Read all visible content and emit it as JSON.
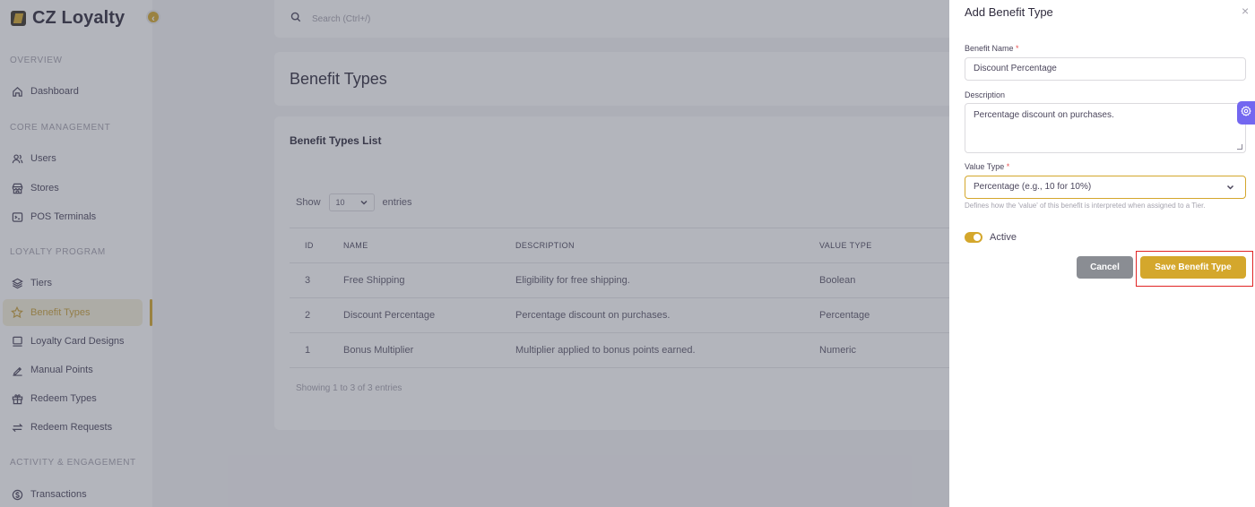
{
  "brand": {
    "name": "CZ Loyalty"
  },
  "sidebar": {
    "sections": {
      "overview": "OVERVIEW",
      "core": "CORE MANAGEMENT",
      "loyalty": "LOYALTY PROGRAM",
      "activity": "ACTIVITY & ENGAGEMENT"
    },
    "items": [
      {
        "label": "Dashboard",
        "icon": "home-icon"
      },
      {
        "label": "Users",
        "icon": "users-icon"
      },
      {
        "label": "Stores",
        "icon": "store-icon"
      },
      {
        "label": "POS Terminals",
        "icon": "terminal-icon"
      },
      {
        "label": "Tiers",
        "icon": "layers-icon"
      },
      {
        "label": "Benefit Types",
        "icon": "star-icon",
        "active": true
      },
      {
        "label": "Loyalty Card Designs",
        "icon": "card-icon"
      },
      {
        "label": "Manual Points",
        "icon": "pen-icon"
      },
      {
        "label": "Redeem Types",
        "icon": "gift-icon"
      },
      {
        "label": "Redeem Requests",
        "icon": "swap-icon"
      },
      {
        "label": "Transactions",
        "icon": "currency-icon"
      }
    ]
  },
  "search": {
    "placeholder": "Search (Ctrl+/)"
  },
  "page": {
    "title": "Benefit Types"
  },
  "list": {
    "title": "Benefit Types List",
    "show_label": "Show",
    "entries_value": "10",
    "entries_label": "entries",
    "columns": [
      "ID",
      "NAME",
      "DESCRIPTION",
      "VALUE TYPE"
    ],
    "rows": [
      {
        "id": "3",
        "name": "Free Shipping",
        "description": "Eligibility for free shipping.",
        "value_type": "Boolean"
      },
      {
        "id": "2",
        "name": "Discount Percentage",
        "description": "Percentage discount on purchases.",
        "value_type": "Percentage"
      },
      {
        "id": "1",
        "name": "Bonus Multiplier",
        "description": "Multiplier applied to bonus points earned.",
        "value_type": "Numeric"
      }
    ],
    "footer": "Showing 1 to 3 of 3 entries"
  },
  "drawer": {
    "title": "Add Benefit Type",
    "close": "×",
    "name_label": "Benefit Name",
    "name_value": "Discount Percentage",
    "description_label": "Description",
    "description_value": "Percentage discount on purchases.",
    "value_type_label": "Value Type",
    "value_type_value": "Percentage (e.g., 10 for 10%)",
    "value_type_help": "Defines how the 'value' of this benefit is interpreted when assigned to a Tier.",
    "required_mark": "*",
    "active_label": "Active",
    "active": true,
    "cancel_label": "Cancel",
    "save_label": "Save Benefit Type"
  },
  "colors": {
    "accent": "#d4a72c",
    "customizer": "#7367f0",
    "highlight": "#e02424"
  }
}
